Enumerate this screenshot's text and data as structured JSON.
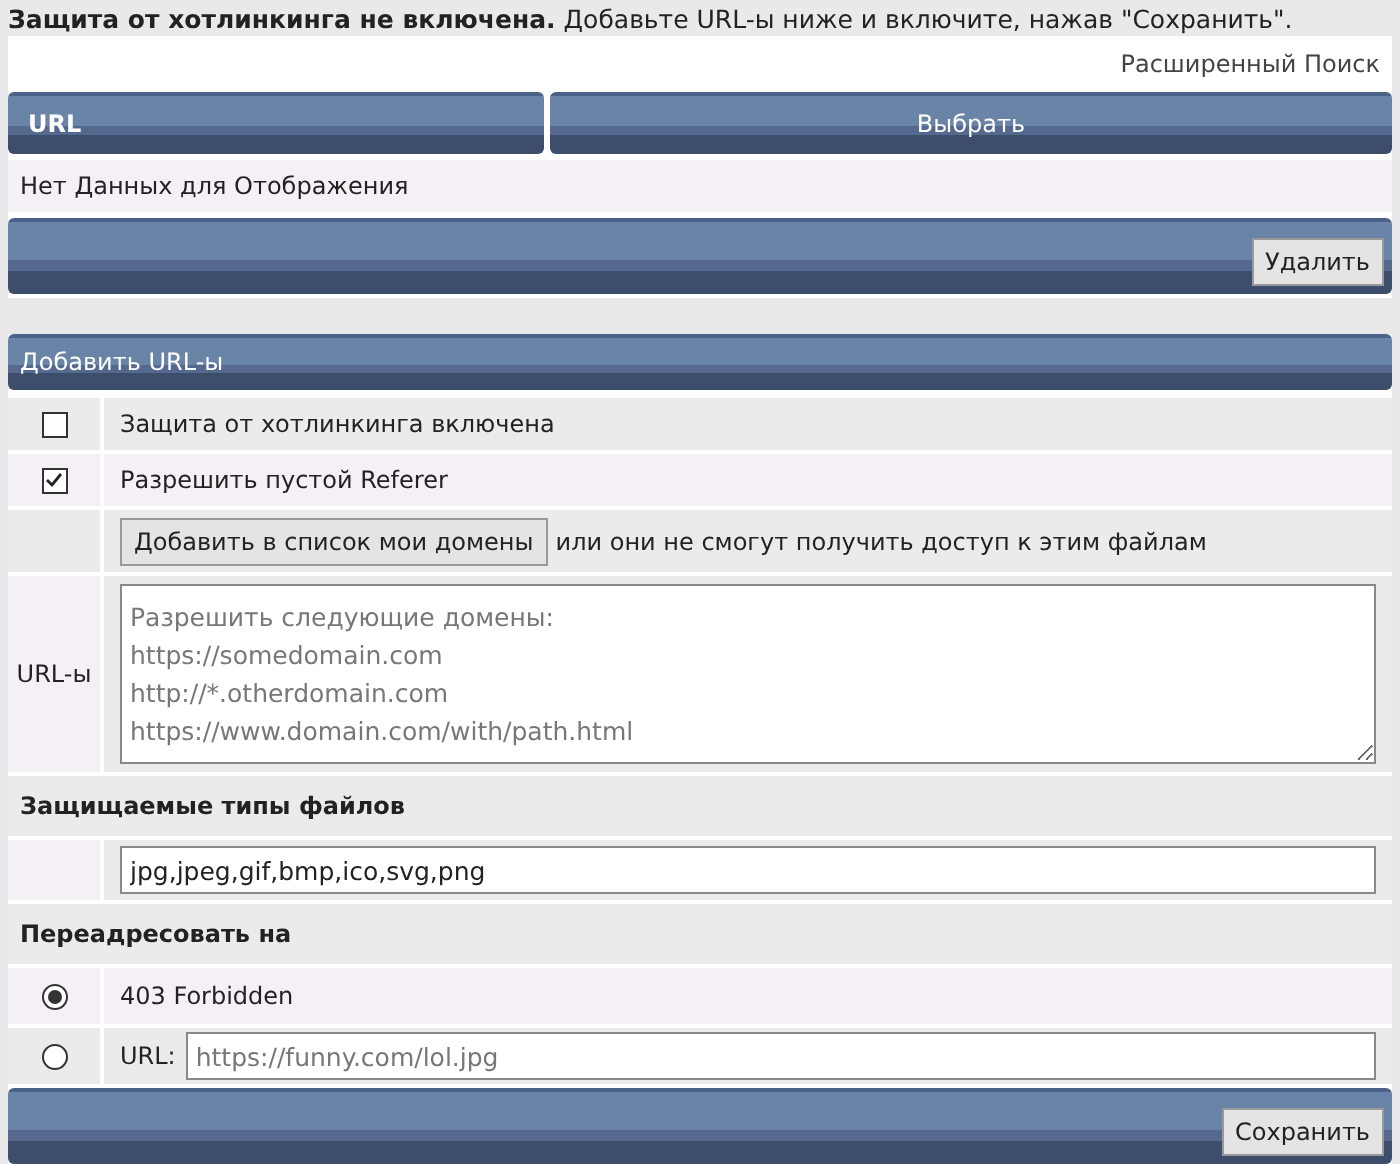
{
  "notice": "**Защита от хотлинкинга не включена.** Добавьте URL-ы ниже и включите, нажав \"Сохранить\".",
  "advanced_search": "Расширенный Поиск",
  "table": {
    "columns": [
      "URL",
      "Выбрать"
    ],
    "empty_text": "Нет Данных для Отображения",
    "delete_button": "Удалить"
  },
  "form": {
    "title": "Добавить URL-ы",
    "options": [
      {
        "label": "Защита от хотлинкинга включена",
        "checked": false
      },
      {
        "label": "Разрешить пустой Referer",
        "checked": true
      }
    ],
    "add_domains_button": "Добавить в список мои домены",
    "add_domains_note": "или они не смогут получить доступ к этим файлам",
    "urls_label": "URL-ы",
    "urls_placeholder": "Разрешить следующие домены:\nhttps://somedomain.com\nhttp://*.otherdomain.com\nhttps://www.domain.com/with/path.html",
    "file_types_heading": "Защищаемые типы файлов",
    "file_types_value": "jpg,jpeg,gif,bmp,ico,svg,png",
    "redirect_heading": "Переадресовать на",
    "redirect_options": [
      {
        "kind": "fixed",
        "label": "403 Forbidden",
        "selected": true
      },
      {
        "kind": "url",
        "label": "URL:",
        "placeholder": "https://funny.com/lol.jpg",
        "selected": false
      }
    ],
    "save_button": "Сохранить"
  }
}
